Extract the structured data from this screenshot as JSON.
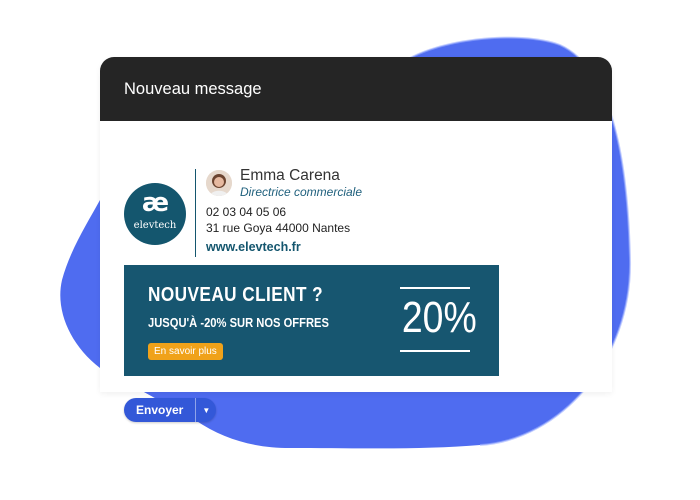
{
  "window": {
    "title": "Nouveau message"
  },
  "signature": {
    "logo": {
      "mark": "æ",
      "text": "elevtech",
      "color": "#14566e"
    },
    "name": "Emma Carena",
    "role": "Directrice commerciale",
    "phone": "02 03 04 05 06",
    "address": "31 rue Goya 44000 Nantes",
    "website": "www.elevtech.fr"
  },
  "banner": {
    "title": "NOUVEAU CLIENT ?",
    "subtitle": "JUSQU'À -20% SUR NOS OFFRES",
    "cta_label": "En savoir plus",
    "percent": "20%",
    "background": "#175670",
    "cta_color": "#f0a21a"
  },
  "actions": {
    "send_label": "Envoyer",
    "send_color": "#3358d8"
  },
  "icons": {
    "avatar": "avatar",
    "dropdown": "chevron-down-icon",
    "decoration": "blue-blob-shape"
  }
}
